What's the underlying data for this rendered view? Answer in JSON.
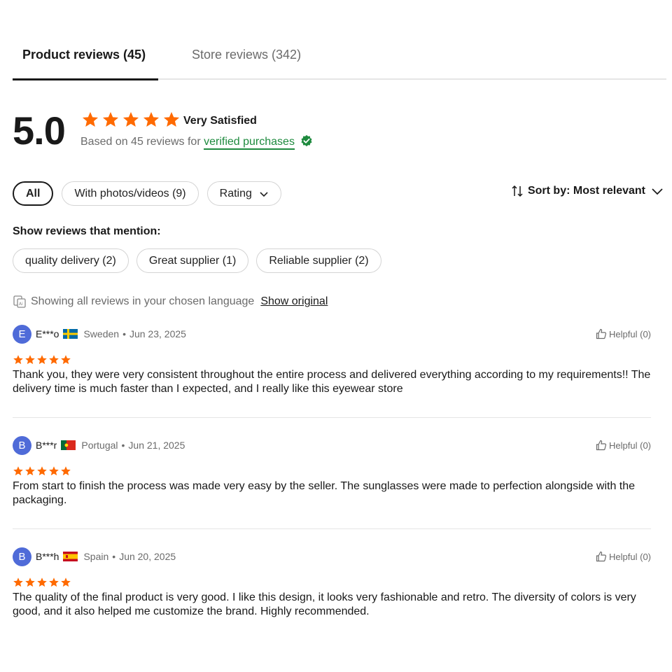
{
  "tabs": {
    "product_label": "Product reviews (45)",
    "store_label": "Store reviews (342)"
  },
  "summary": {
    "score": "5.0",
    "stars": 5,
    "satisfaction": "Very Satisfied",
    "based_on": "Based on 45 reviews for",
    "verified_link": "verified purchases",
    "star_color": "#ff6a00",
    "verified_color": "#1e8a3e"
  },
  "filters": {
    "all": "All",
    "photos": "With photos/videos (9)",
    "rating": "Rating"
  },
  "sort": {
    "label": "Sort by: Most relevant"
  },
  "mentions": {
    "title": "Show reviews that mention:",
    "chips": [
      "quality delivery (2)",
      "Great supplier (1)",
      "Reliable supplier (2)"
    ]
  },
  "language": {
    "notice": "Showing all reviews in your chosen language",
    "show_original": "Show original"
  },
  "reviews": [
    {
      "initial": "E",
      "name": "E***o",
      "country": "Sweden",
      "date": "Jun 23, 2025",
      "flag": "sweden-flag",
      "stars": 5,
      "helpful": "Helpful (0)",
      "text": "Thank you, they were very consistent throughout the entire process and delivered everything according to my requirements!! The delivery time is much faster than I expected, and I really like this eyewear store"
    },
    {
      "initial": "B",
      "name": "B***r",
      "country": "Portugal",
      "date": "Jun 21, 2025",
      "flag": "portugal-flag",
      "stars": 5,
      "helpful": "Helpful (0)",
      "text": "From start to finish the process was made very easy by the seller. The sunglasses were made to perfection alongside with the packaging."
    },
    {
      "initial": "B",
      "name": "B***h",
      "country": "Spain",
      "date": "Jun 20, 2025",
      "flag": "spain-flag",
      "stars": 5,
      "helpful": "Helpful (0)",
      "text": "The quality of the final product is very good. I like this design, it looks very fashionable and retro. The diversity of colors is very good, and it also helped me customize the brand. Highly recommended."
    }
  ]
}
